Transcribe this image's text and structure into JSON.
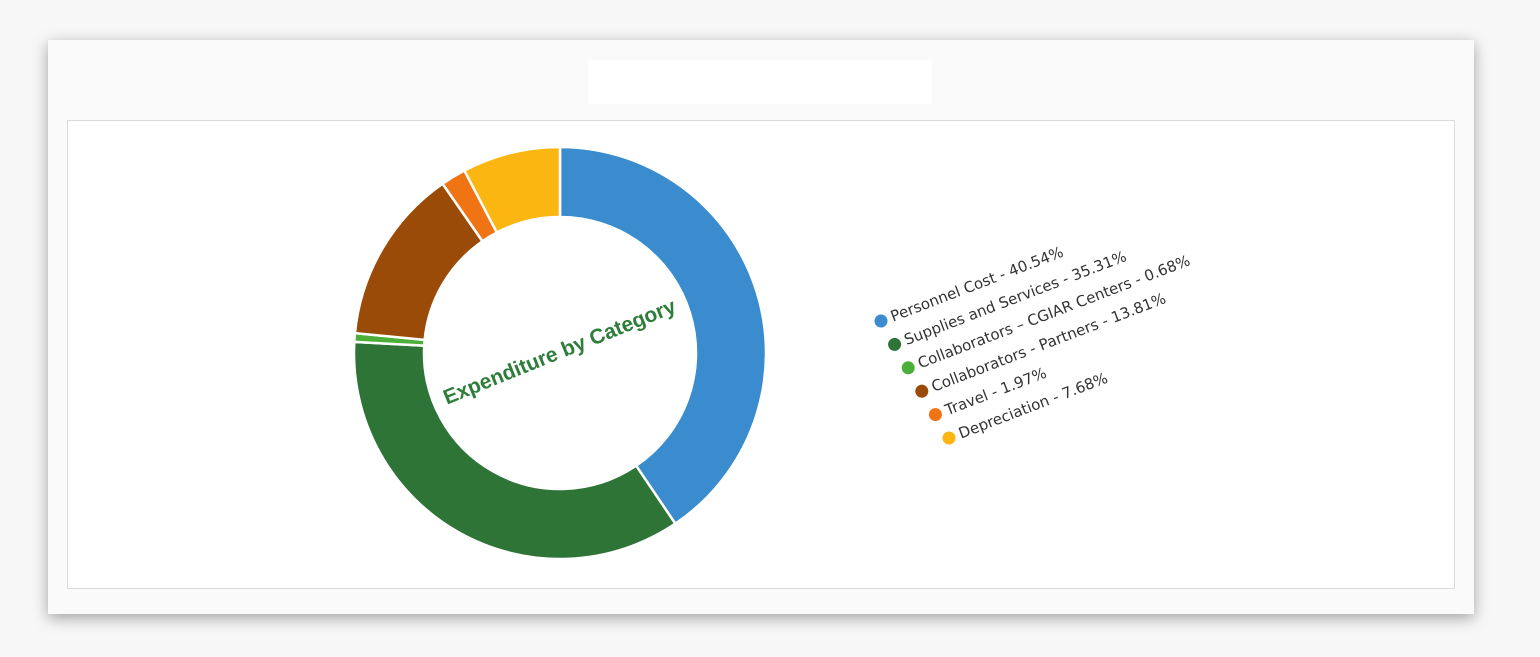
{
  "card": {
    "title": ""
  },
  "chart_data": {
    "type": "pie",
    "donut": true,
    "center_label": "Expenditure by Category",
    "slices": [
      {
        "label": "Personnel Cost",
        "value": 40.54,
        "color": "#3a8ccf"
      },
      {
        "label": "Supplies and Services",
        "value": 35.31,
        "color": "#2e7436"
      },
      {
        "label": "Collaborators – CGIAR Centers",
        "value": 0.68,
        "color": "#4caf3a"
      },
      {
        "label": "Collaborators - Partners",
        "value": 13.81,
        "color": "#9a4b08"
      },
      {
        "label": "Travel",
        "value": 1.97,
        "color": "#f07314"
      },
      {
        "label": "Depreciation",
        "value": 7.68,
        "color": "#fbb612"
      }
    ],
    "legend_position": "right",
    "legend_rotation": "tilted"
  }
}
